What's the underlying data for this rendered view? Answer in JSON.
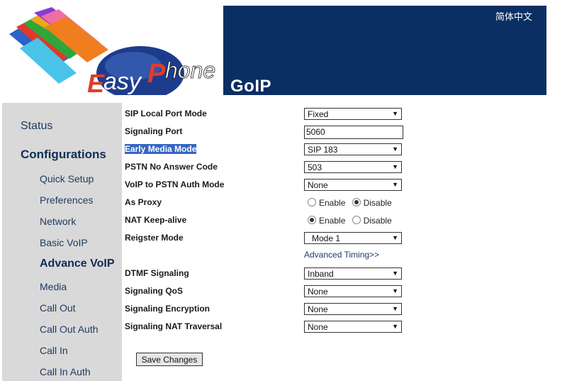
{
  "header": {
    "logo_text": "EasyPhone",
    "product_name": "GoIP",
    "language_link": "简体中文"
  },
  "sidebar": {
    "status": "Status",
    "configurations": "Configurations",
    "items": [
      {
        "label": "Quick Setup"
      },
      {
        "label": "Preferences"
      },
      {
        "label": "Network"
      },
      {
        "label": "Basic VoIP"
      },
      {
        "label": "Advance VoIP",
        "active": true
      },
      {
        "label": "Media"
      },
      {
        "label": "Call Out"
      },
      {
        "label": "Call Out Auth"
      },
      {
        "label": "Call In"
      },
      {
        "label": "Call In Auth"
      }
    ]
  },
  "form": {
    "sip_local_port_mode": {
      "label": "SIP Local Port Mode",
      "value": "Fixed"
    },
    "signaling_port": {
      "label": "Signaling Port",
      "value": "5060"
    },
    "early_media_mode": {
      "label": "Early Media Mode",
      "value": "SIP 183"
    },
    "pstn_no_answer_code": {
      "label": "PSTN No Answer Code",
      "value": "503"
    },
    "voip_to_pstn_auth_mode": {
      "label": "VoIP to PSTN Auth Mode",
      "value": "None"
    },
    "as_proxy": {
      "label": "As Proxy",
      "enable_label": "Enable",
      "disable_label": "Disable",
      "selected": "Disable"
    },
    "nat_keep_alive": {
      "label": "NAT Keep-alive",
      "enable_label": "Enable",
      "disable_label": "Disable",
      "selected": "Enable"
    },
    "reigster_mode": {
      "label": "Reigster Mode",
      "value": "Mode 1"
    },
    "advanced_timing": "Advanced Timing>>",
    "dtmf_signaling": {
      "label": "DTMF Signaling",
      "value": "Inband"
    },
    "signaling_qos": {
      "label": "Signaling QoS",
      "value": "None"
    },
    "signaling_encryption": {
      "label": "Signaling Encryption",
      "value": "None"
    },
    "signaling_nat_traversal": {
      "label": "Signaling NAT Traversal",
      "value": "None"
    },
    "save_button": "Save Changes"
  },
  "colors": {
    "header_bg": "#0b2f63",
    "sidebar_bg": "#d9d9d9",
    "highlight": "#3566c4"
  }
}
